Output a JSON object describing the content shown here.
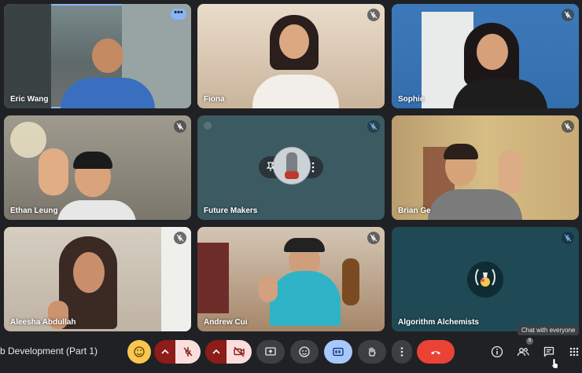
{
  "meeting": {
    "title": "b Development (Part 1)"
  },
  "participants": [
    {
      "name": "Eric Wang",
      "mic": "active"
    },
    {
      "name": "Fiona",
      "mic": "muted"
    },
    {
      "name": "Sophie",
      "mic": "muted"
    },
    {
      "name": "Ethan Leung",
      "mic": "muted"
    },
    {
      "name": "Future Makers",
      "mic": "muted"
    },
    {
      "name": "Brian Ge",
      "mic": "muted"
    },
    {
      "name": "Aleesha Abdullah",
      "mic": "muted"
    },
    {
      "name": "Andrew Cui",
      "mic": "muted"
    },
    {
      "name": "Algorithm Alchemists",
      "mic": "muted"
    }
  ],
  "toolbar": {
    "chat_tooltip": "Chat with everyone",
    "people_count": "9",
    "icons": [
      "reactions-icon",
      "mic-off-icon",
      "camera-off-icon",
      "present-icon",
      "emoji-icon",
      "captions-icon",
      "raise-hand-icon",
      "more-options-icon",
      "hang-up-icon",
      "info-icon",
      "people-icon",
      "chat-icon",
      "activities-icon"
    ]
  },
  "colors": {
    "background": "#202124",
    "accent": "#8ab4f8",
    "danger": "#ea4335",
    "muted_button": "#f9dedc",
    "muted_button_dark": "#8c1d18"
  }
}
